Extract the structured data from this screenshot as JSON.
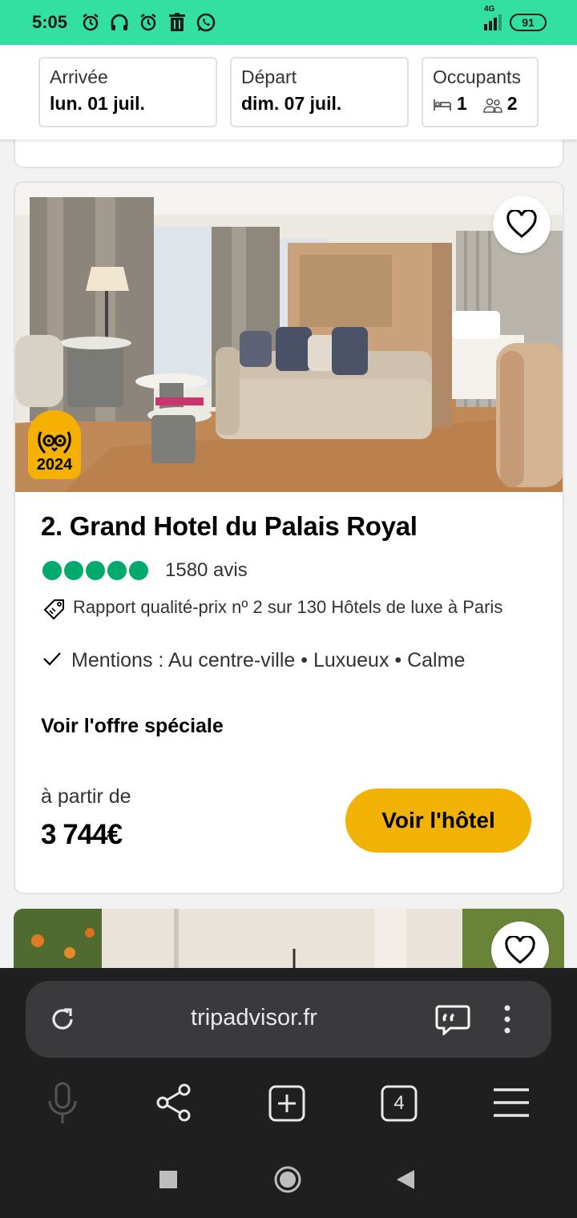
{
  "status": {
    "time": "5:05",
    "network": "4G",
    "battery": "91"
  },
  "dates": {
    "arrival_label": "Arrivée",
    "arrival_value": "lun. 01 juil.",
    "departure_label": "Départ",
    "departure_value": "dim. 07 juil.",
    "guests_label": "Occupants",
    "rooms": "1",
    "people": "2"
  },
  "hotel": {
    "badge_year": "2024",
    "title": "2. Grand Hotel du Palais Royal",
    "rating_bubbles": 5,
    "reviews": "1580 avis",
    "value_text": "Rapport qualité-prix nº 2 sur 130 Hôtels de luxe à Paris",
    "mentions": "Mentions : Au centre-ville • Luxueux • Calme",
    "special_offer": "Voir l'offre spéciale",
    "from_label": "à partir de",
    "price": "3 744€",
    "cta": "Voir l'hôtel"
  },
  "browser": {
    "url": "tripadvisor.fr",
    "tab_count": "4"
  },
  "colors": {
    "brand_green": "#34e0a1",
    "bubble_green": "#00aa6c",
    "cta_yellow": "#f2b203"
  }
}
